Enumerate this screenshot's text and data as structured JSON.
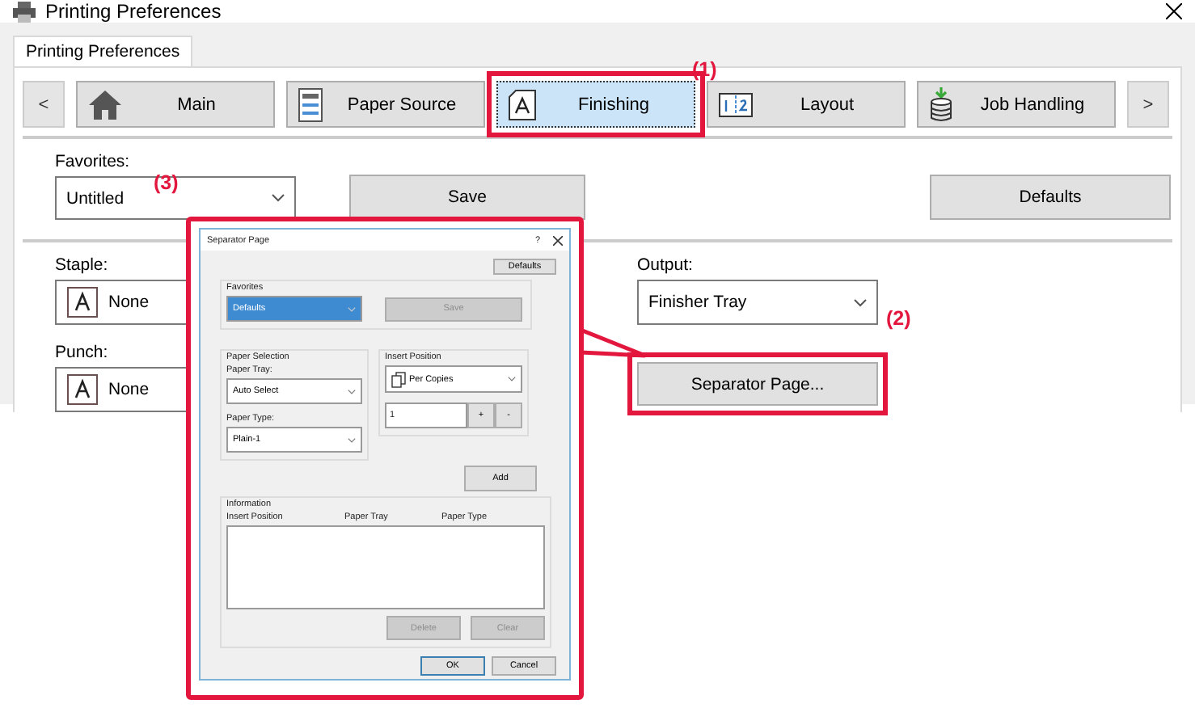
{
  "window": {
    "title": "Printing Preferences"
  },
  "tabs": [
    {
      "label": "Printing Preferences",
      "selected": true
    }
  ],
  "nav": {
    "prev": "<",
    "next": ">",
    "items": [
      {
        "label": "Main",
        "selected": false
      },
      {
        "label": "Paper Source",
        "selected": false
      },
      {
        "label": "Finishing",
        "selected": true
      },
      {
        "label": "Layout",
        "selected": false
      },
      {
        "label": "Job Handling",
        "selected": false
      }
    ]
  },
  "favorites": {
    "label": "Favorites:",
    "value": "Untitled",
    "save": "Save",
    "defaults": "Defaults"
  },
  "staple": {
    "label": "Staple:",
    "value": "None"
  },
  "punch": {
    "label": "Punch:",
    "value": "None"
  },
  "output": {
    "label": "Output:",
    "value": "Finisher Tray"
  },
  "separator_button": "Separator Page...",
  "annotations": [
    "(1)",
    "(2)",
    "(3)"
  ],
  "separator_dialog": {
    "title": "Separator Page",
    "help": "?",
    "defaults": "Defaults",
    "favorites": {
      "label": "Favorites",
      "value": "Defaults",
      "highlighted": true,
      "save": "Save",
      "save_disabled": true
    },
    "paper_selection": {
      "label": "Paper Selection",
      "tray_label": "Paper Tray:",
      "tray": "Auto Select",
      "type_label": "Paper Type:",
      "type": "Plain-1"
    },
    "insert_position": {
      "label": "Insert Position",
      "value": "Per Copies",
      "count": "1",
      "plus": "+",
      "minus": "-"
    },
    "add": "Add",
    "information": {
      "label": "Information",
      "columns": [
        "Insert Position",
        "Paper Tray",
        "Paper Type"
      ]
    },
    "buttons": [
      {
        "label": "Delete",
        "disabled": true
      },
      {
        "label": "Clear",
        "disabled": true
      }
    ],
    "ok": "OK",
    "cancel": "Cancel"
  }
}
